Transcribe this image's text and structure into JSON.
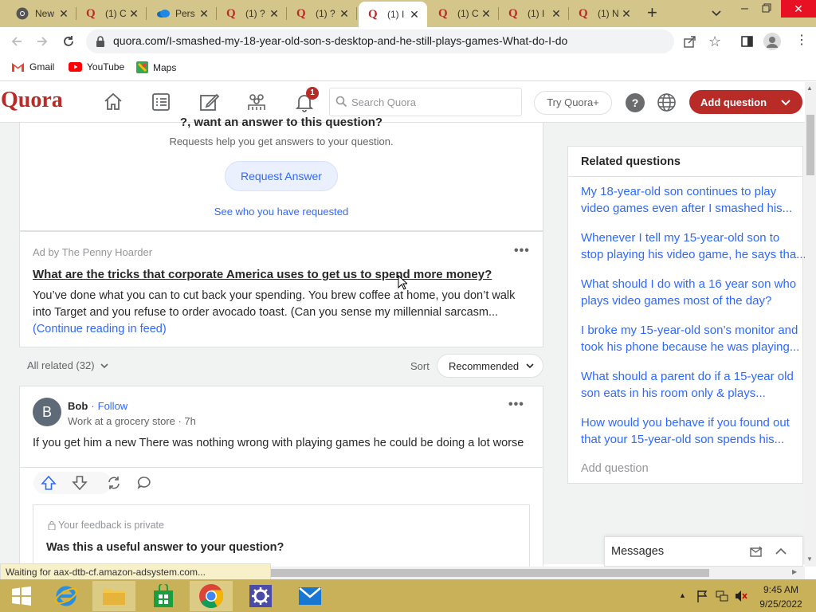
{
  "browser": {
    "tabs": [
      {
        "title": "New",
        "icon": "chrome-icon"
      },
      {
        "title": "(1) C",
        "icon": "quora-icon"
      },
      {
        "title": "Pers",
        "icon": "onedrive-icon"
      },
      {
        "title": "(1) ?",
        "icon": "quora-icon"
      },
      {
        "title": "(1) ?",
        "icon": "quora-icon"
      },
      {
        "title": "(1) I",
        "icon": "quora-icon",
        "active": true
      },
      {
        "title": "(1) C",
        "icon": "quora-icon"
      },
      {
        "title": "(1) I",
        "icon": "quora-icon"
      },
      {
        "title": "(1) N",
        "icon": "quora-icon"
      }
    ],
    "url": "quora.com/I-smashed-my-18-year-old-son-s-desktop-and-he-still-plays-games-What-do-I-do",
    "bookmarks": [
      "Gmail",
      "YouTube",
      "Maps"
    ],
    "status_text": "Waiting for aax-dtb-cf.amazon-adsystem.com..."
  },
  "quora": {
    "logo": "Quora",
    "notification_count": "1",
    "search_placeholder": "Search Quora",
    "try_plus": "Try Quora+",
    "help": "?",
    "add_question": "Add question"
  },
  "request": {
    "heading_partial": "?, want an answer to this question?",
    "subtext": "Requests help you get answers to your question.",
    "button": "Request Answer",
    "link": "See who you have requested"
  },
  "ad": {
    "by": "Ad by The Penny Hoarder",
    "title": "What are the tricks that corporate America uses to get us to spend more money?",
    "body": "You’ve done what you can to cut back your spending. You brew coffee at home, you don’t walk into Target and you refuse to order avocado toast. (Can you sense my millennial sarcasm...",
    "continue": "(Continue reading in feed)"
  },
  "filter": {
    "all_related": "All related (32)",
    "sort_label": "Sort",
    "sort_value": "Recommended"
  },
  "answer": {
    "avatar_letter": "B",
    "author": "Bob",
    "follow": "Follow",
    "credential": "Work at a grocery store · 7h",
    "text": "If you get him a new There was nothing wrong with playing games he could be doing a lot worse",
    "feedback_private": "Your feedback is private",
    "feedback_question": "Was this a useful answer to your question?"
  },
  "related": {
    "title": "Related questions",
    "items": [
      {
        "line1": "My 18-year-old son continues to play",
        "line2": "video games even after I smashed his..."
      },
      {
        "line1": "Whenever I tell my 15-year-old son to",
        "line2": "stop playing his video game, he says tha..."
      },
      {
        "line1": "What should I do with a 16 year son who",
        "line2": "plays video games most of the day?"
      },
      {
        "line1": "I broke my 15-year-old son’s monitor and",
        "line2": "took his phone because he was playing..."
      },
      {
        "line1": "What should a parent do if a 15-year old",
        "line2": "son eats in his room only & plays..."
      },
      {
        "line1": "How would you behave if you found out",
        "line2": "that your 15-year-old son spends his..."
      }
    ],
    "add_question": "Add question"
  },
  "messages": {
    "title": "Messages"
  },
  "taskbar": {
    "time": "9:45 AM",
    "date": "9/25/2022"
  },
  "colors": {
    "quora_red": "#b92b27",
    "link_blue": "#2e69ff",
    "taskbar": "#c9b15a",
    "tabstrip": "#d4c58a"
  }
}
